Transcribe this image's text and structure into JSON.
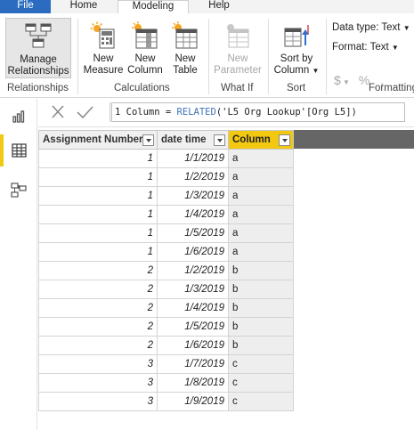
{
  "tabs": {
    "file": "File",
    "home": "Home",
    "modeling": "Modeling",
    "help": "Help"
  },
  "ribbon": {
    "manage_relationships": {
      "line1": "Manage",
      "line2": "Relationships"
    },
    "new_measure": {
      "line1": "New",
      "line2": "Measure"
    },
    "new_column": {
      "line1": "New",
      "line2": "Column"
    },
    "new_table": {
      "line1": "New",
      "line2": "Table"
    },
    "new_parameter": {
      "line1": "New",
      "line2": "Parameter"
    },
    "sort_by_column": {
      "line1": "Sort by",
      "line2": "Column"
    },
    "data_type": "Data type: Text",
    "format": "Format: Text",
    "format_symbols": {
      "currency": "$",
      "percent": "%",
      "comma": ","
    },
    "groups": {
      "relationships": "Relationships",
      "calculations": "Calculations",
      "what_if": "What If",
      "sort": "Sort",
      "formatting": "Formatting"
    }
  },
  "rail": {
    "items": [
      "report-view-icon",
      "data-view-icon",
      "model-view-icon"
    ],
    "active": "data-view-icon"
  },
  "formula_bar": {
    "line_number": "1",
    "text_before": " Column = ",
    "function_name": "RELATED",
    "text_after": "('L5 Org Lookup'[Org L5])"
  },
  "table": {
    "columns": [
      "Assignment Number",
      "date time",
      "Column"
    ],
    "selected_column": "Column",
    "rows": [
      [
        "1",
        "1/1/2019",
        "a"
      ],
      [
        "1",
        "1/2/2019",
        "a"
      ],
      [
        "1",
        "1/3/2019",
        "a"
      ],
      [
        "1",
        "1/4/2019",
        "a"
      ],
      [
        "1",
        "1/5/2019",
        "a"
      ],
      [
        "1",
        "1/6/2019",
        "a"
      ],
      [
        "2",
        "1/2/2019",
        "b"
      ],
      [
        "2",
        "1/3/2019",
        "b"
      ],
      [
        "2",
        "1/4/2019",
        "b"
      ],
      [
        "2",
        "1/5/2019",
        "b"
      ],
      [
        "2",
        "1/6/2019",
        "b"
      ],
      [
        "3",
        "1/7/2019",
        "c"
      ],
      [
        "3",
        "1/8/2019",
        "c"
      ],
      [
        "3",
        "1/9/2019",
        "c"
      ]
    ]
  },
  "colors": {
    "accent_yellow": "#f2c811",
    "file_tab_blue": "#2b6cc0",
    "function_blue": "#3f72b8"
  }
}
